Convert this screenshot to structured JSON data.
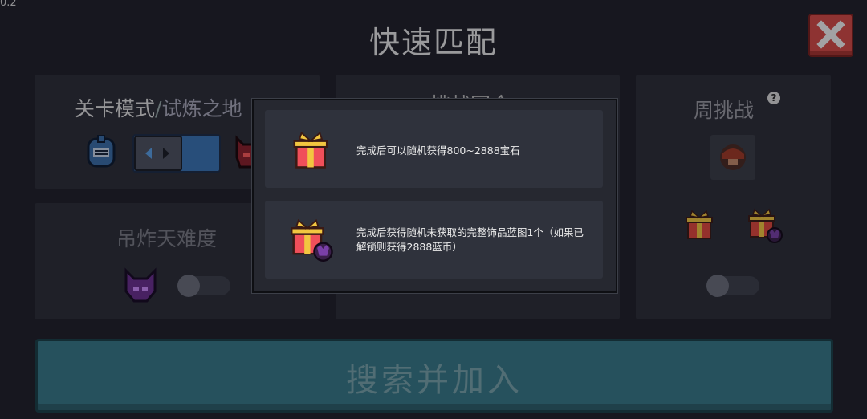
{
  "version": "0.2",
  "title": "快速匹配",
  "close_icon": "close-x-icon",
  "panels": {
    "level_mode": {
      "label_main": "关卡模式",
      "label_sep": "/",
      "label_sub": "试炼之地"
    },
    "hidden_middle": {
      "label": "挑战回合"
    },
    "weekly_challenge": {
      "label": "周挑战",
      "help": "?"
    },
    "bomb_difficulty": {
      "label": "吊炸天难度"
    }
  },
  "popup": {
    "rewards": [
      {
        "icon": "gift-icon",
        "text": "完成后可以随机获得800~2888宝石"
      },
      {
        "icon": "gift-demon-icon",
        "text": "完成后获得随机未获取的完整饰品蓝图1个（如果已解锁则获得2888蓝币）"
      }
    ]
  },
  "search_button": {
    "label": "搜索并加入"
  },
  "colors": {
    "background": "#1f2028",
    "panel": "#2b2d37",
    "close": "#d64a45",
    "search": "#3c8fa0",
    "selector": "#3a73b4"
  }
}
